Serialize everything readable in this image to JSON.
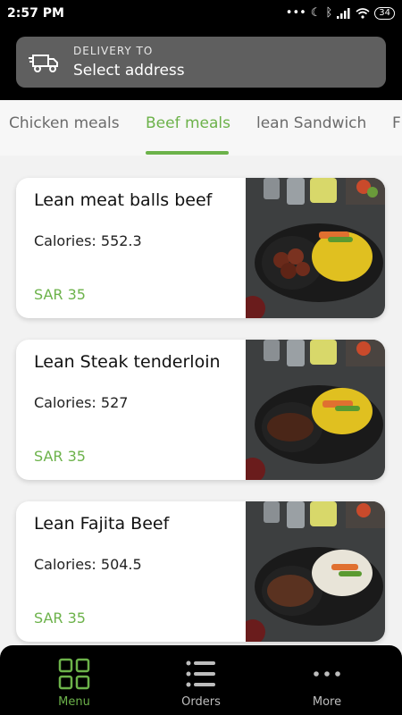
{
  "status": {
    "time": "2:57 PM",
    "battery": "34",
    "icons": [
      "dots-icon",
      "moon-icon",
      "bluetooth-icon",
      "signal-icon",
      "wifi-icon",
      "battery-icon"
    ]
  },
  "header": {
    "delivery_label": "DELIVERY TO",
    "address_value": "Select address",
    "icon": "truck-icon"
  },
  "tabs": [
    {
      "label": "Chicken meals",
      "active": false
    },
    {
      "label": "Beef meals",
      "active": true
    },
    {
      "label": "lean Sandwich",
      "active": false
    },
    {
      "label": "F",
      "active": false
    }
  ],
  "meals": [
    {
      "name": "Lean meat balls beef",
      "calories": "Calories: 552.3",
      "price": "SAR 35",
      "image": "meatballs-rice-dish"
    },
    {
      "name": "Lean Steak tenderloin",
      "calories": "Calories: 527",
      "price": "SAR 35",
      "image": "steak-rice-dish"
    },
    {
      "name": "Lean Fajita Beef",
      "calories": "Calories: 504.5",
      "price": "SAR 35",
      "image": "fajita-beef-rice-dish"
    }
  ],
  "nav": [
    {
      "label": "Menu",
      "icon": "grid-icon",
      "active": true
    },
    {
      "label": "Orders",
      "icon": "list-icon",
      "active": false
    },
    {
      "label": "More",
      "icon": "more-dots-icon",
      "active": false
    }
  ],
  "colors": {
    "accent": "#6cb24a",
    "header_bg": "#000000",
    "address_bar_bg": "#5f5f5f",
    "page_bg": "#f2f2f2"
  }
}
